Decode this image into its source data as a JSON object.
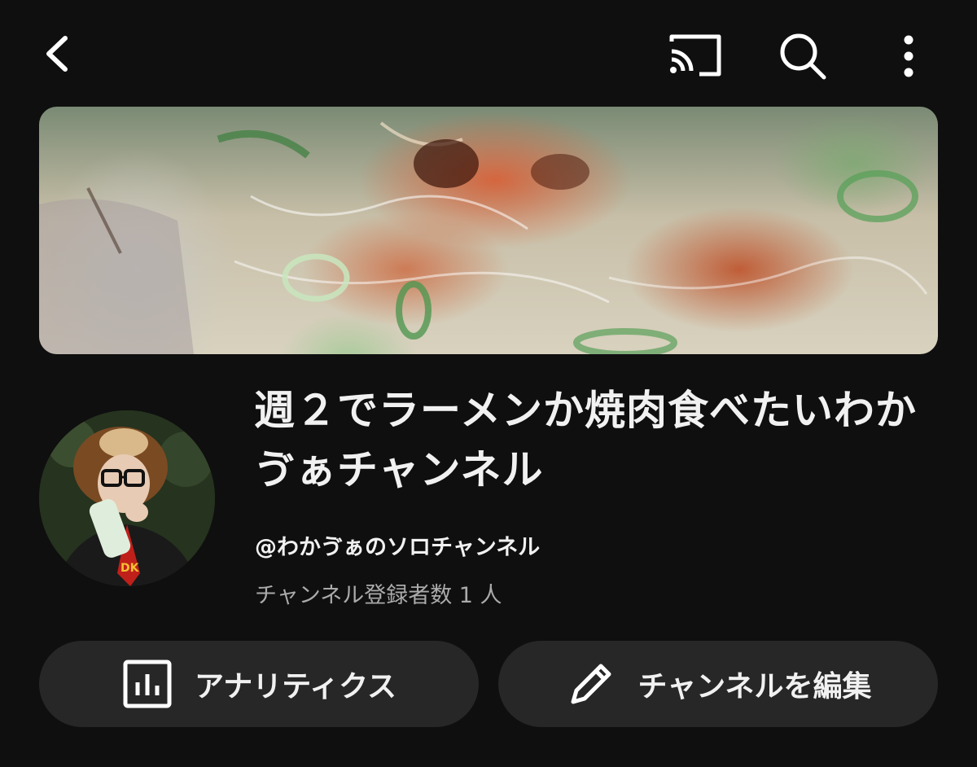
{
  "header": {
    "back_icon": "chevron-left-icon",
    "cast_icon": "cast-icon",
    "search_icon": "search-icon",
    "more_icon": "more-vertical-icon"
  },
  "channel": {
    "name": "週２でラーメンか焼肉食べたいわかゔぁチャンネル",
    "handle": "@わかゔぁのソロチャンネル",
    "subscribers": "チャンネル登録者数 1 人"
  },
  "actions": {
    "analytics_label": "アナリティクス",
    "analytics_icon": "bar-chart-icon",
    "edit_label": "チャンネルを編集",
    "edit_icon": "pencil-icon"
  },
  "colors": {
    "background": "#0f0f0f",
    "button_bg": "#272727",
    "secondary_text": "#aaaaaa"
  }
}
